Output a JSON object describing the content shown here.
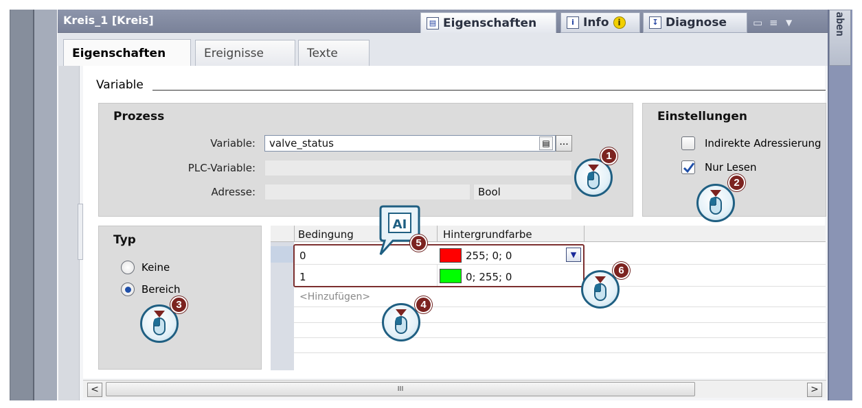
{
  "window": {
    "title": "Kreis_1 [Kreis]",
    "side_tab": "aben"
  },
  "top_tabs": [
    {
      "label": "Eigenschaften",
      "icon": "properties-icon"
    },
    {
      "label": "Info",
      "icon": "info-icon"
    },
    {
      "label": "Diagnose",
      "icon": "diagnostics-icon"
    }
  ],
  "sub_tabs": [
    "Eigenschaften",
    "Ereignisse",
    "Texte"
  ],
  "section": {
    "heading": "Variable"
  },
  "prozess": {
    "title": "Prozess",
    "variable_label": "Variable:",
    "variable_value": "valve_status",
    "plc_label": "PLC-Variable:",
    "plc_value": "",
    "adresse_label": "Adresse:",
    "adresse_value": "",
    "type_value": "Bool",
    "browse_button": "..."
  },
  "einstellungen": {
    "title": "Einstellungen",
    "indirekt_label": "Indirekte Adressierung",
    "indirekt_checked": false,
    "nurlesen_label": "Nur Lesen",
    "nurlesen_checked": true
  },
  "typ": {
    "title": "Typ",
    "keine_label": "Keine",
    "bereich_label": "Bereich",
    "selected": "Bereich"
  },
  "table": {
    "headers": [
      "Bedingung",
      "Hintergrundfarbe"
    ],
    "rows": [
      {
        "bedingung": "0",
        "farbe": "255; 0; 0",
        "swatch": "#ff0000"
      },
      {
        "bedingung": "1",
        "farbe": "0; 255; 0",
        "swatch": "#00ff00"
      }
    ],
    "add_placeholder": "<Hinzufügen>"
  },
  "callouts": [
    "1",
    "2",
    "3",
    "4",
    "5",
    "6"
  ],
  "scrollbar": {
    "left": "<",
    "right": ">",
    "grip": "III"
  },
  "colors": {
    "accent": "#7c2320",
    "titlebar": "#8590a8",
    "mouse_ring": "#1f5f82"
  }
}
